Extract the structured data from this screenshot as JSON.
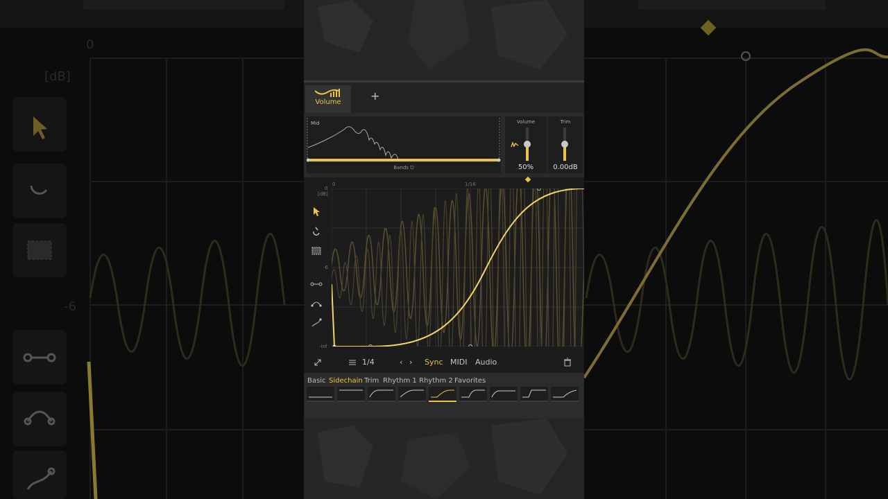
{
  "tabs": {
    "volume_label": "Volume",
    "add_label": "+"
  },
  "eq": {
    "band_label": "Mid",
    "bands_label": "Bands"
  },
  "faders": {
    "volume": {
      "label": "Volume",
      "value": "50%",
      "level": 0.5
    },
    "trim": {
      "label": "Trim",
      "value": "0.00dB",
      "level": 0.5
    }
  },
  "graph": {
    "y_top": "0",
    "y_unit": "[dB]",
    "y_mid": "-6",
    "y_bottom": "-inf",
    "x_start": "0",
    "x_mid": "1/16"
  },
  "bottombar": {
    "rate": "1/4",
    "sync": "Sync",
    "midi": "MIDI",
    "audio": "Audio"
  },
  "presets": {
    "tabs": [
      "Basic",
      "Sidechain",
      "Trim",
      "Rhythm 1",
      "Rhythm 2",
      "Favorites"
    ],
    "active_tab": "Sidechain"
  },
  "background": {
    "y_top": "0",
    "y_unit": "[dB]",
    "y_mid": "-6"
  },
  "colors": {
    "accent": "#e8c547",
    "panel": "#2a2a2a",
    "graph_bg": "#1c1c1c"
  }
}
